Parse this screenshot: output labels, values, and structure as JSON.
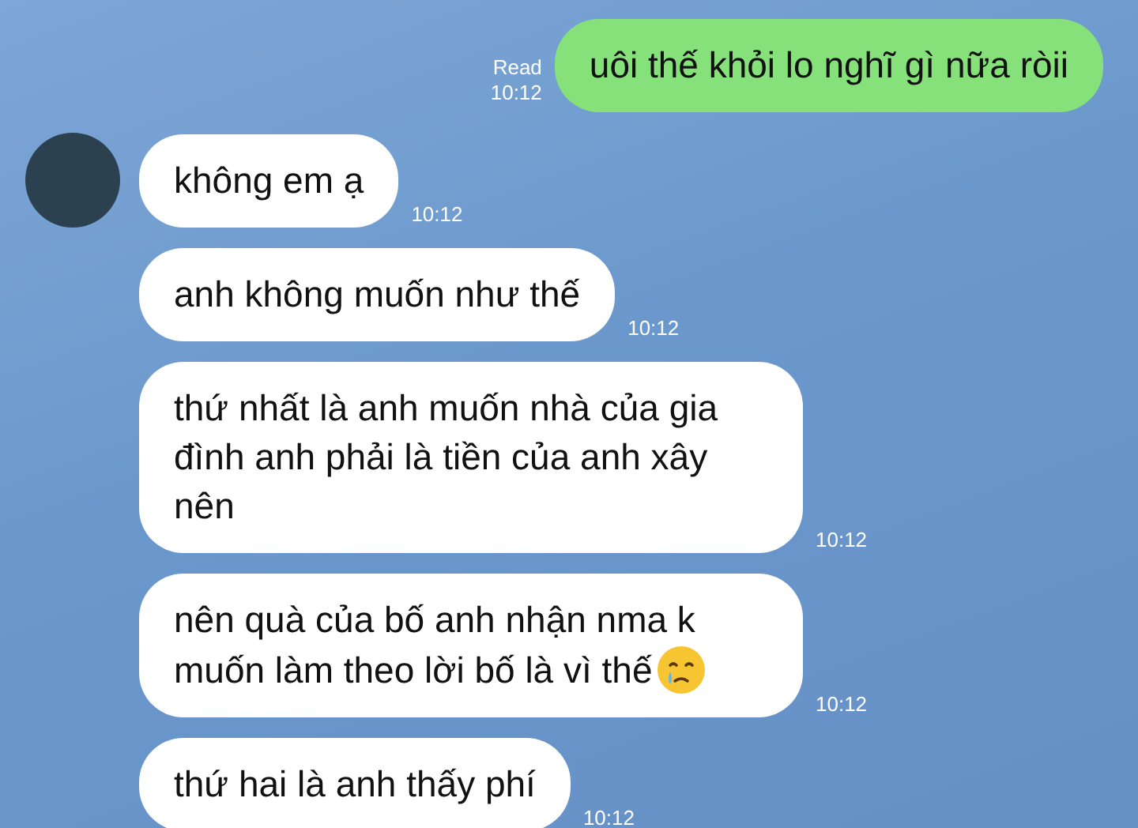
{
  "messages": [
    {
      "kind": "outgoing",
      "text": "uôi thế khỏi lo nghĩ gì nữa ròii",
      "time": "10:12",
      "status": "Read",
      "emoji": false
    },
    {
      "kind": "incoming",
      "text": "không em ạ",
      "time": "10:12",
      "avatar": true,
      "emoji": false
    },
    {
      "kind": "incoming",
      "text": "anh không muốn như thế",
      "time": "10:12",
      "avatar": false,
      "emoji": false
    },
    {
      "kind": "incoming",
      "text": "thứ nhất là anh muốn nhà của gia đình anh phải là tiền của anh xây nên",
      "time": "10:12",
      "avatar": false,
      "emoji": false
    },
    {
      "kind": "incoming",
      "text": "nên quà của bố anh nhận nma k muốn làm theo lời bố là vì thế",
      "time": "10:12",
      "avatar": false,
      "emoji": true
    },
    {
      "kind": "incoming",
      "text": "thứ hai là anh thấy phí",
      "time": "10:12",
      "avatar": false,
      "emoji": false
    }
  ]
}
